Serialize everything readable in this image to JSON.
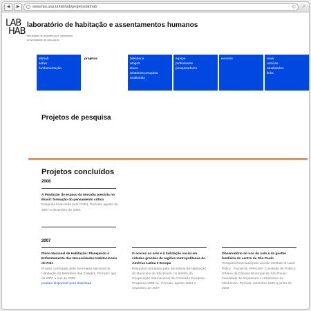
{
  "browser": {
    "back": "◀",
    "forward": "▶",
    "url": "www.fau.usp.br/labhab/projetoslabhab",
    "reload": "C",
    "resize": "↗"
  },
  "header": {
    "logo_line1": "LAB",
    "logo_line2": "HAB",
    "title": "laboratório de habitação e assentamentos humanos",
    "sub1": "faculdade de arquitetura e urbanismo",
    "sub2": "universidade de são paulo"
  },
  "menu": {
    "col1": [
      "labhab",
      "sobre",
      "fundamentação"
    ],
    "col2": [
      "projetos"
    ],
    "col3": [
      "biblioteca",
      "artigos",
      "teses",
      "relatórios pesquisa",
      "multimídia"
    ],
    "col4": [
      "equipe",
      "professores",
      "pesquisadores"
    ],
    "col5": [
      "eventos"
    ],
    "col6": [
      "mais",
      "notícias",
      "atualidades",
      "links"
    ],
    "accent": "#0048e0"
  },
  "main": {
    "heading": "Projetos de pesquisa",
    "concluded_heading": "Projetos concluídos",
    "year1": "2008",
    "year2": "2007",
    "accent": "#f26c2a"
  },
  "projects2008": [
    {
      "title": "A Produção do espaço da moradia precária no Brasil: formação do pensamento crítico",
      "body": "Pesquisa financiada pelo CNPq. Período: agosto de 2007 a dezembro de 2008."
    }
  ],
  "projects2007": [
    {
      "title": "Plano Nacional de Habitação: Planejando o Enfrentamento das Necessidades Habitacionais do País",
      "body": "Projeto contratado pela Secretaria Nacional de Habitação do Ministério das Cidades. Período: ago de 2007 a mai de 2008",
      "link": "produto disponível para download"
    },
    {
      "title": "O acesso ao solo e à habitação social em cidades grandes de regiões metropolitanas da América Latina e Europa",
      "body": "Pesquisa contratada pela Secretaria de Habitação do Município de São Paulo, no âmbito da Cooperação Internacional da Comissão Europeia - Programa URB AL. Período: agosto 2004 a novembro de 2007"
    },
    {
      "title": "Observatório do uso do solo e da gestão fundiária do centro de São Paulo",
      "body": "Pesquisa financiada pelo Lincoln Institute of Land Policy . Parceiros: PRAUSP, Comissão de Política Urbana da Câmara Municipal de São Paulo; Faculdade de Arquitetura e Urbanismo da Mackenzie. Período: setembro 2005 a junho de 2006"
    }
  ]
}
